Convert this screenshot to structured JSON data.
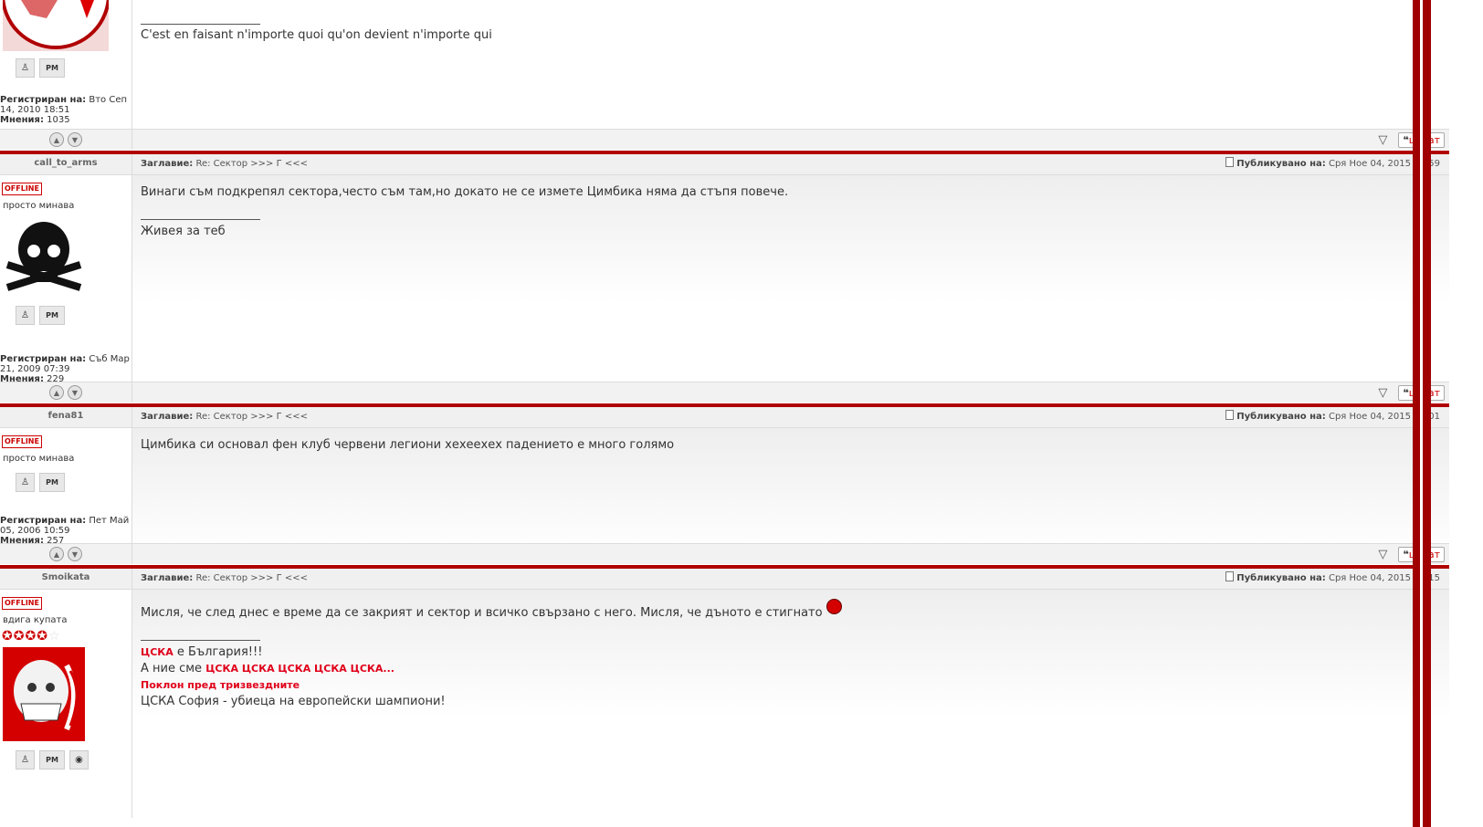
{
  "posts": [
    {
      "partial": true,
      "signature": "C'est en faisant n'importe quoi qu'on devient n'importe qui",
      "reg_label": "Регистриран на:",
      "reg_date": "Вто Сеп 14, 2010 18:51",
      "posts_label": "Мнения:",
      "posts_count": "1035",
      "quote_label": "цитат"
    },
    {
      "author": "call_to_arms",
      "status": "OFFLINE",
      "rank": "просто минава",
      "subject_label": "Заглавие:",
      "subject": "Re: Сектор >>> Г <<<",
      "posted_label": "Публикувано на:",
      "posted": "Сря Ное 04, 2015 19:59",
      "body": "Винаги съм подкрепял сектора,често съм там,но докато не се измете Цимбика няма да стъпя повече.",
      "signature": "Живея за теб",
      "reg_label": "Регистриран на:",
      "reg_date": "Съб Мар 21, 2009 07:39",
      "posts_label": "Мнения:",
      "posts_count": "229",
      "quote_label": "цитат"
    },
    {
      "author": "fena81",
      "status": "OFFLINE",
      "rank": "просто минава",
      "subject_label": "Заглавие:",
      "subject": "Re: Сектор >>> Г <<<",
      "posted_label": "Публикувано на:",
      "posted": "Сря Ное 04, 2015 20:01",
      "body": "Цимбика си основал фен клуб червени легиони хехеехех падението е много голямо",
      "reg_label": "Регистриран на:",
      "reg_date": "Пет Май 05, 2006 10:59",
      "posts_label": "Мнения:",
      "posts_count": "257",
      "quote_label": "цитат"
    },
    {
      "author": "Smoikata",
      "status": "OFFLINE",
      "rank": "вдига купата",
      "stars_filled": 4,
      "stars_total": 5,
      "subject_label": "Заглавие:",
      "subject": "Re: Сектор >>> Г <<<",
      "posted_label": "Публикувано на:",
      "posted": "Сря Ное 04, 2015 20:15",
      "body": "Мисля, че след днес е време да се закрият и сектор и всичко свързано с него. Мисля, че дъното е стигнато",
      "sig1_red": "ЦСКА",
      "sig1_rest": " е България!!!",
      "sig2_prefix": "А ние сме ",
      "sig2_red": "ЦСКА ЦСКА ЦСКА ЦСКА ЦСКА...",
      "sig3": "Поклон пред тризвездните",
      "sig4": "ЦСКА София - убиеца на европейски шампиони!"
    }
  ],
  "pm_label": "PM",
  "icons": [
    "profile-icon",
    "pm-icon",
    "www-icon",
    "up-arrow-icon",
    "down-arrow-icon",
    "report-icon",
    "sad-smiley-icon"
  ]
}
